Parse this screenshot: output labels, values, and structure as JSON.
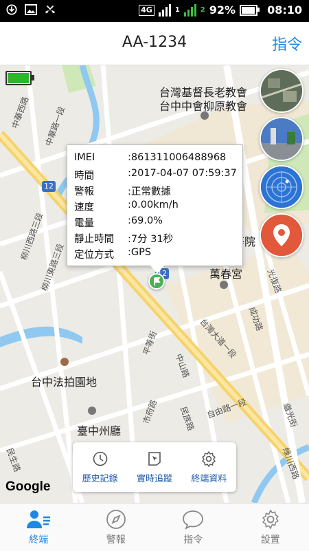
{
  "status_bar": {
    "network": "4G",
    "sim1": "1",
    "sim2": "2",
    "battery": "92%",
    "time": "08:10"
  },
  "header": {
    "title": "AA-1234",
    "command_label": "指令"
  },
  "device_battery_level": 0.9,
  "map": {
    "labels": {
      "church": "台灣基督長老教會",
      "church2": "台中中會柳原教會",
      "hospital": "等院",
      "temple": "萬春宮",
      "auction": "台中法拍園地",
      "cityhall": "臺中州廳",
      "road_taiwan": "台灣大道一段",
      "road_zhonghua": "中華路一段",
      "road_liuchuan": "柳川西路三段",
      "road_liuchuan2": "柳川東路三段",
      "road_chenggong": "成功路",
      "road_guangfu": "光復路",
      "road_zhongshan": "中山路",
      "road_minzu": "民族路",
      "road_shifu": "市府路",
      "road_ziyou": "自由路一段",
      "road_pingdeng": "平等街",
      "road_jiguang": "繼光街",
      "road_minsheng": "民生路",
      "road_liuchuan3": "綠川西路",
      "road_huaxi": "中華西路",
      "route": "12"
    },
    "google": "Google"
  },
  "popup": {
    "rows": [
      {
        "key": "IMEI",
        "value": ":861311006488968"
      },
      {
        "key": "時間",
        "value": ":2017-04-07 07:59:37"
      },
      {
        "key": "警報",
        "value": ":正常數據"
      },
      {
        "key": "速度",
        "value": ":0.00km/h"
      },
      {
        "key": "電量",
        "value": ":69.0%"
      },
      {
        "key": "靜止時間",
        "value": ":7分 31秒"
      },
      {
        "key": "定位方式",
        "value": ":GPS"
      }
    ]
  },
  "actions": [
    {
      "label": "歷史記錄",
      "icon": "clock-icon"
    },
    {
      "label": "實時追蹤",
      "icon": "tracking-icon"
    },
    {
      "label": "終端資料",
      "icon": "gear-icon"
    }
  ],
  "bottom_nav": [
    {
      "label": "終端",
      "icon": "user-list-icon",
      "active": true
    },
    {
      "label": "警報",
      "icon": "compass-icon",
      "active": false
    },
    {
      "label": "指令",
      "icon": "chat-bubble-icon",
      "active": false
    },
    {
      "label": "設置",
      "icon": "settings-icon",
      "active": false
    }
  ],
  "colors": {
    "accent": "#1e88e5",
    "action_text": "#1e5aa8",
    "road_major": "#f6d36a",
    "water": "#8fc8f0",
    "park": "#cfe8b8"
  }
}
